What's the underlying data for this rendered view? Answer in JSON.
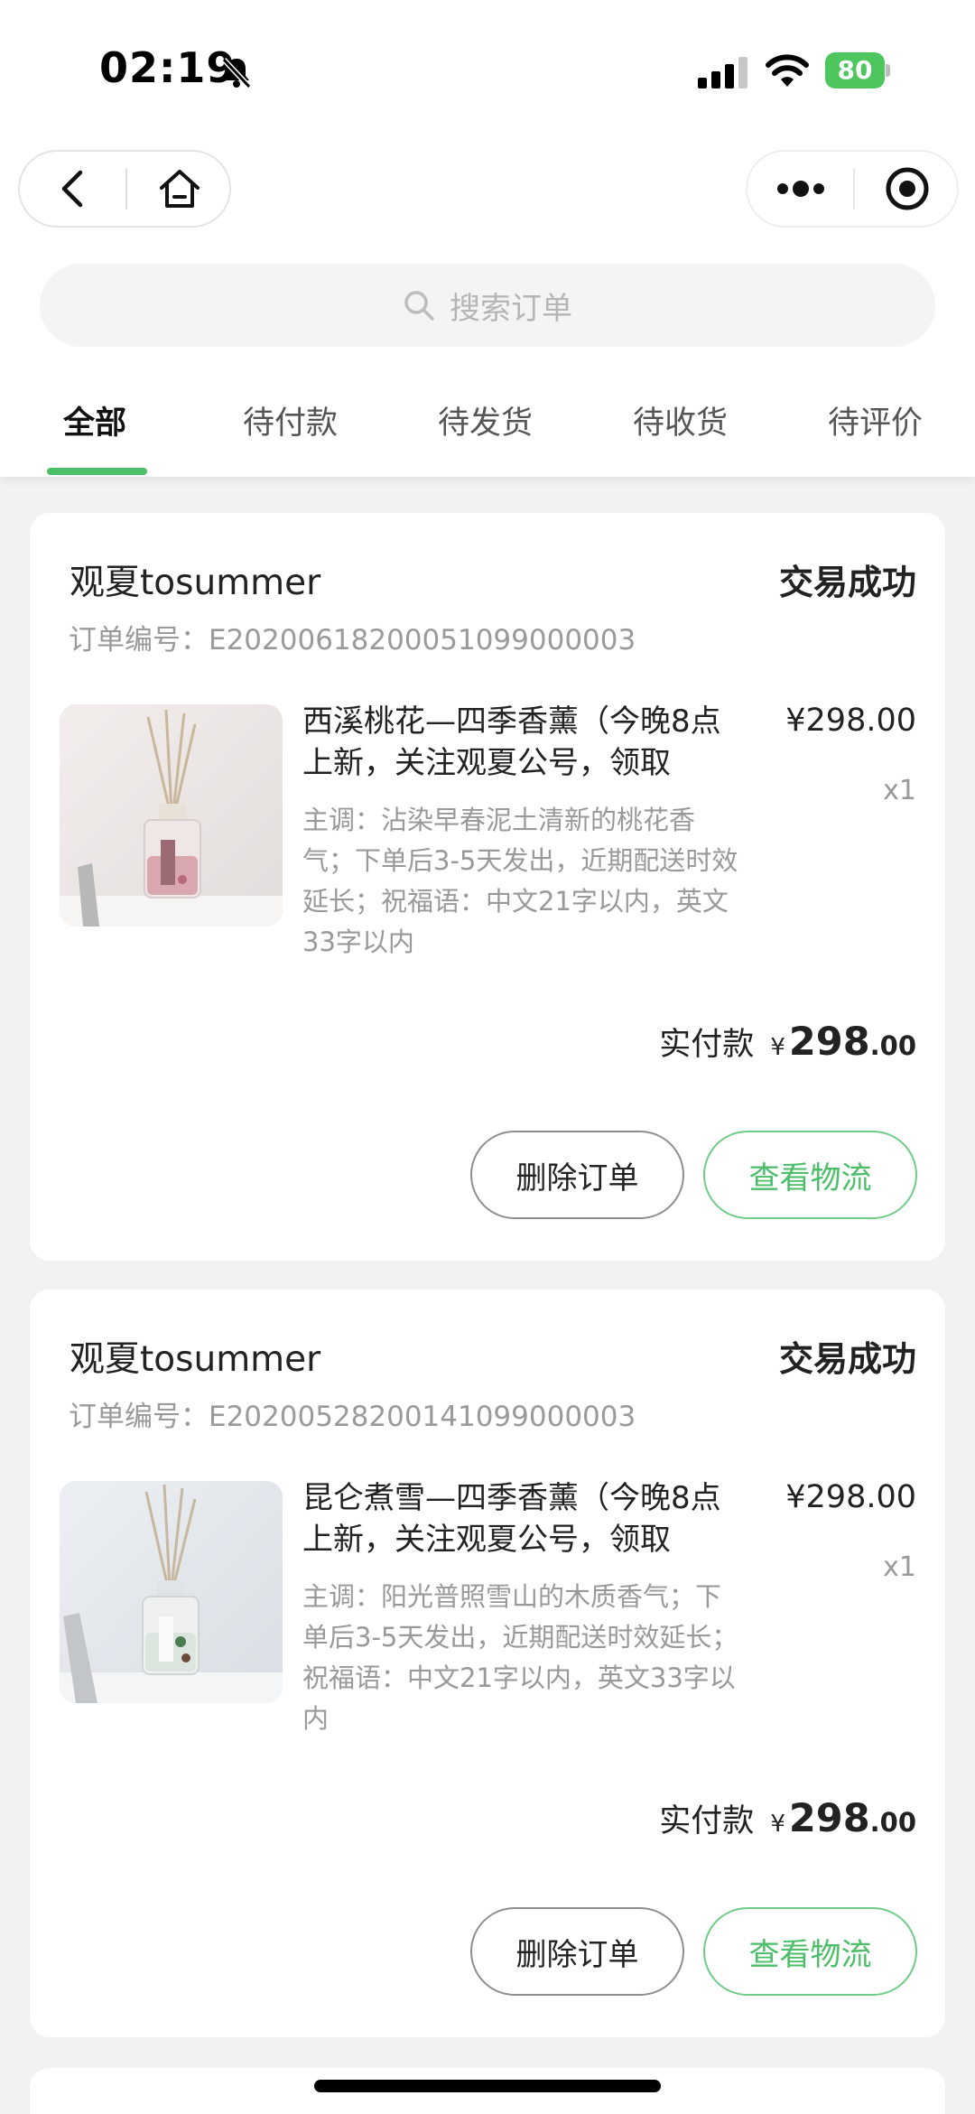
{
  "status_bar": {
    "time": "02:19",
    "battery": "80"
  },
  "icons": {
    "bell": "bell-slash-icon",
    "signal": "signal-icon",
    "wifi": "wifi-icon",
    "battery": "battery-charging-icon",
    "back": "chevron-left-icon",
    "home": "home-icon",
    "more": "more-dots-icon",
    "close": "target-circle-icon",
    "search": "search-icon"
  },
  "colors": {
    "accent": "#4cbe68",
    "battery": "#4cc65d",
    "background": "#f2f2f2"
  },
  "search": {
    "placeholder": "搜索订单"
  },
  "tabs": [
    {
      "label": "全部",
      "active": true
    },
    {
      "label": "待付款",
      "active": false
    },
    {
      "label": "待发货",
      "active": false
    },
    {
      "label": "待收货",
      "active": false
    },
    {
      "label": "待评价",
      "active": false
    }
  ],
  "orders": [
    {
      "shop": "观夏tosummer",
      "status": "交易成功",
      "order_no": "订单编号：E20200618200051099000003",
      "product": {
        "title": "西溪桃花—四季香薰（今晚8点上新，关注观夏公号，领取",
        "desc": "主调：沾染早春泥土清新的桃花香气；下单后3-5天发出，近期配送时效延长；祝福语：中文21字以内，英文33字以内",
        "price": "¥298.00",
        "qty": "x1"
      },
      "paid_label": "实付款",
      "paid_currency": "¥",
      "paid_int": "298",
      "paid_dec": ".00",
      "delete_label": "删除订单",
      "logistics_label": "查看物流"
    },
    {
      "shop": "观夏tosummer",
      "status": "交易成功",
      "order_no": "订单编号：E20200528200141099000003",
      "product": {
        "title": "昆仑煮雪—四季香薰（今晚8点上新，关注观夏公号，领取",
        "desc": "主调：阳光普照雪山的木质香气；下单后3-5天发出，近期配送时效延长；祝福语：中文21字以内，英文33字以内",
        "price": "¥298.00",
        "qty": "x1"
      },
      "paid_label": "实付款",
      "paid_currency": "¥",
      "paid_int": "298",
      "paid_dec": ".00",
      "delete_label": "删除订单",
      "logistics_label": "查看物流"
    }
  ]
}
